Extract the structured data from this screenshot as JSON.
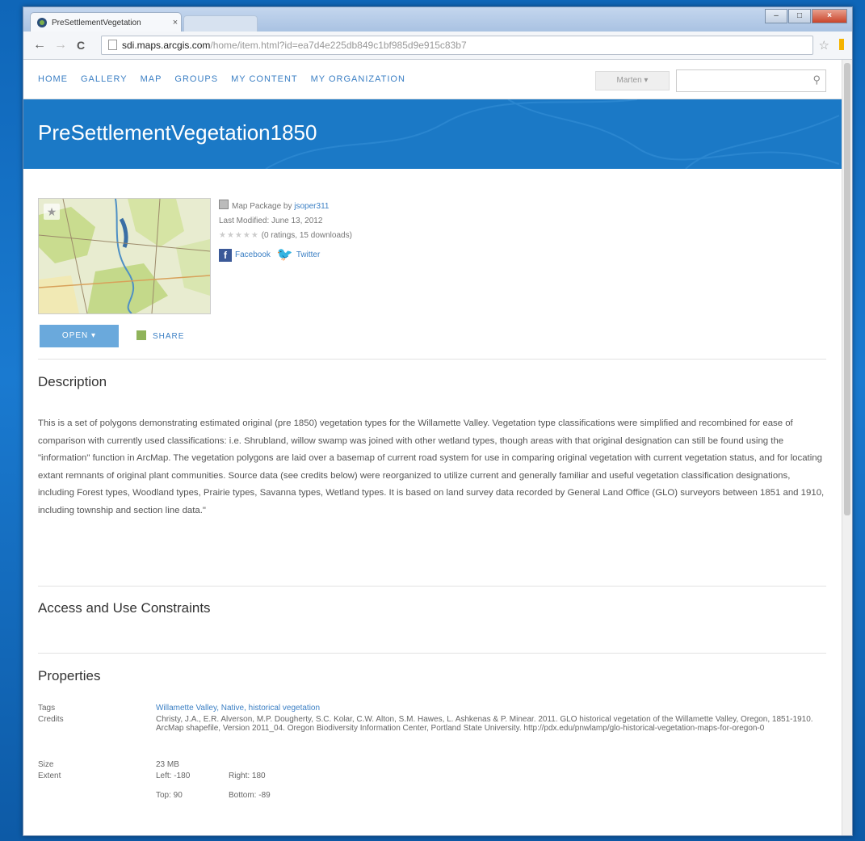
{
  "browser": {
    "tab_title": "PreSettlementVegetation",
    "tab_close": "×",
    "url_host": "sdi.maps.arcgis.com",
    "url_path": "/home/item.html?id=ea7d4e225db849c1bf985d9e915c83b7",
    "back_icon": "←",
    "forward_icon": "→",
    "reload_icon": "C",
    "star_icon": "☆"
  },
  "nav": {
    "items": [
      "HOME",
      "GALLERY",
      "MAP",
      "GROUPS",
      "MY CONTENT",
      "MY ORGANIZATION"
    ],
    "user_label": "Marten ▾",
    "search_placeholder": "",
    "search_icon": "⚲"
  },
  "banner": {
    "title": "PreSettlementVegetation1850",
    "color": "#1b79c6"
  },
  "item": {
    "type_prefix": "Map Package by ",
    "owner": "jsoper311",
    "last_modified": "Last Modified: June 13, 2012",
    "stars": "★★★★★",
    "ratings": "(0 ratings, 15 downloads)",
    "facebook": "Facebook",
    "twitter": "Twitter",
    "open_label": "OPEN ▾",
    "share_label": "SHARE"
  },
  "description": {
    "heading": "Description",
    "text": "This is a set of polygons demonstrating estimated original (pre 1850) vegetation types for the Willamette Valley. Vegetation type classifications were simplified and recombined for ease of comparison with currently used classifications: i.e. Shrubland, willow swamp was joined with other wetland types, though areas with that original designation can still be found using the \"information\" function in ArcMap. The vegetation polygons are laid over a basemap of current road system for use in comparing original vegetation with current vegetation status, and for locating extant remnants of original plant communities. Source data (see credits below) were reorganized to utilize current and generally familiar and useful vegetation classification designations, including Forest types, Woodland types, Prairie types, Savanna types, Wetland types. It is based on land survey data recorded by General Land Office (GLO) surveyors between 1851 and 1910, including township and section line data.\""
  },
  "access": {
    "heading": "Access and Use Constraints"
  },
  "properties": {
    "heading": "Properties",
    "tags_label": "Tags",
    "tags_value": "Willamette Valley, Native, historical vegetation",
    "credits_label": "Credits",
    "credits_value": "Christy, J.A., E.R. Alverson, M.P. Dougherty, S.C. Kolar, C.W. Alton, S.M. Hawes, L. Ashkenas & P. Minear. 2011. GLO historical vegetation of the Willamette Valley, Oregon, 1851-1910. ArcMap shapefile, Version 2011_04. Oregon Biodiversity Information Center, Portland State University. http://pdx.edu/pnwlamp/glo-historical-vegetation-maps-for-oregon-0",
    "size_label": "Size",
    "size_value": "23 MB",
    "extent_label": "Extent",
    "extent_left": "Left: -180",
    "extent_right": "Right: 180",
    "extent_top": "Top: 90",
    "extent_bottom": "Bottom: -89"
  }
}
